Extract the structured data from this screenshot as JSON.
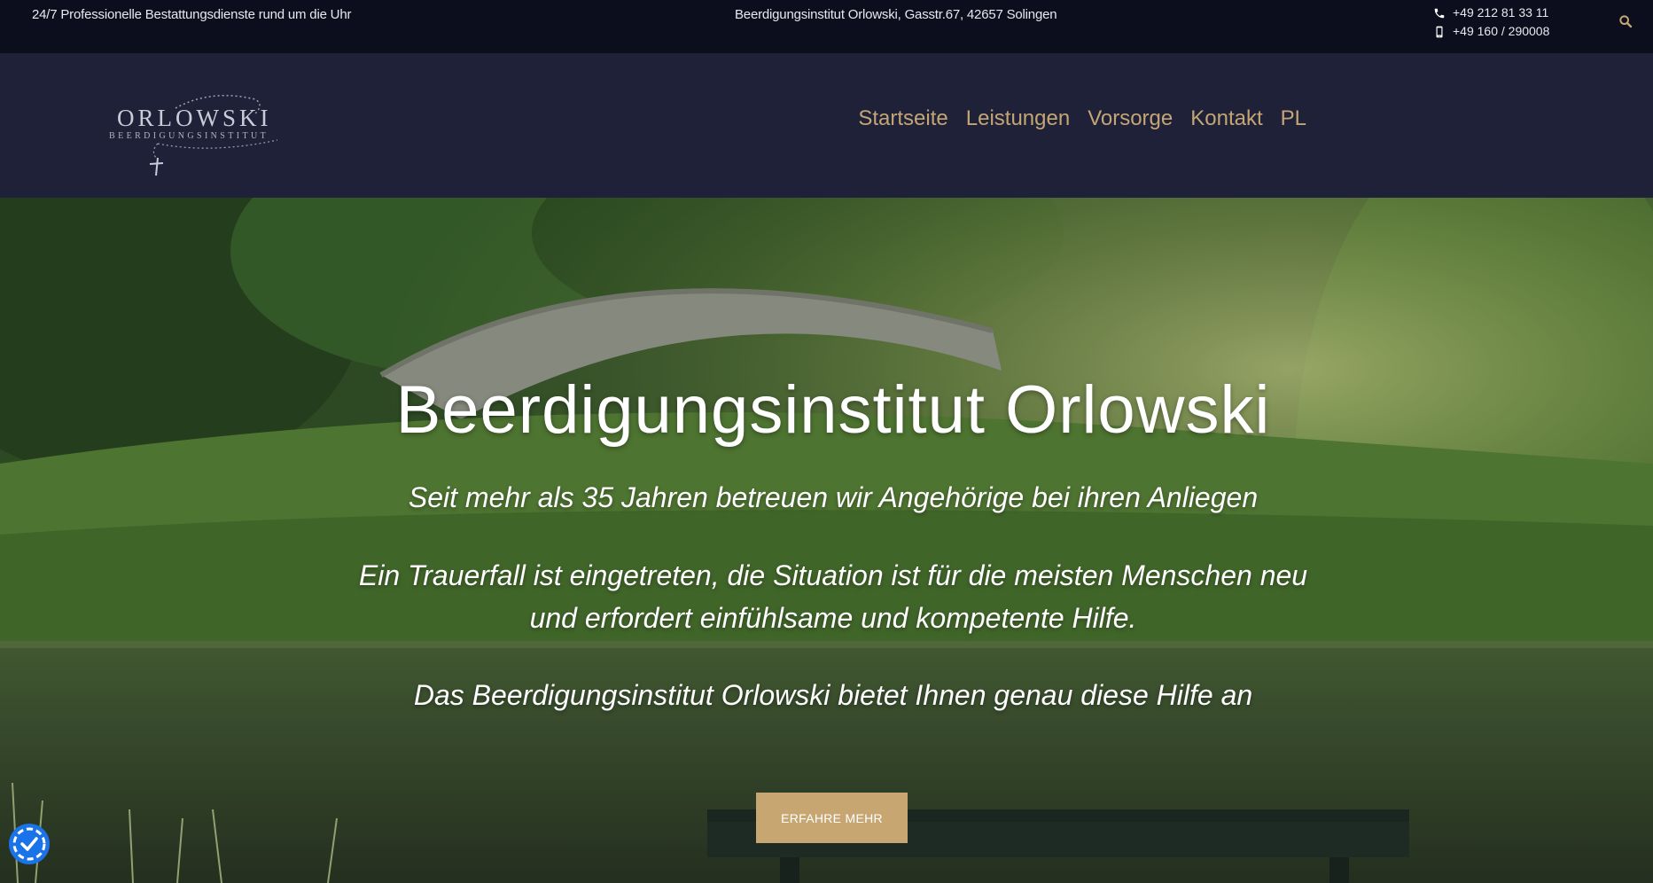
{
  "topbar": {
    "tagline": "24/7 Professionelle Bestattungsdienste rund um die Uhr",
    "address": "Beerdigungsinstitut Orlowski, Gasstr.67, 42657 Solingen",
    "phone": "+49 212 81 33 11",
    "mobile": "+49 160 / 290008",
    "icons": [
      "phone-icon",
      "mobile-icon",
      "search-icon"
    ]
  },
  "header": {
    "logo": {
      "main": "ORLOWSKI",
      "sub": "BEERDIGUNGSINSTITUT"
    },
    "nav": [
      {
        "label": "Startseite"
      },
      {
        "label": "Leistungen"
      },
      {
        "label": "Vorsorge"
      },
      {
        "label": "Kontakt"
      },
      {
        "label": "PL"
      }
    ]
  },
  "hero": {
    "title": "Beerdigungsinstitut Orlowski",
    "lines": [
      "Seit mehr als 35 Jahren betreuen wir Angehörige bei ihren Anliegen",
      "Ein Trauerfall ist eingetreten, die Situation ist für die meisten Menschen neu",
      "und erfordert einfühlsame und kompetente Hilfe.",
      "Das Beerdigungsinstitut  Orlowski bietet Ihnen genau diese Hilfe an"
    ],
    "cta_label": "ERFAHRE MEHR"
  },
  "colors": {
    "topbar_bg": "#0d0e1d",
    "header_bg": "#1f2139",
    "nav_link": "#c4a574",
    "cta_bg": "#c7a672",
    "cookie_badge": "#1a73e8"
  }
}
